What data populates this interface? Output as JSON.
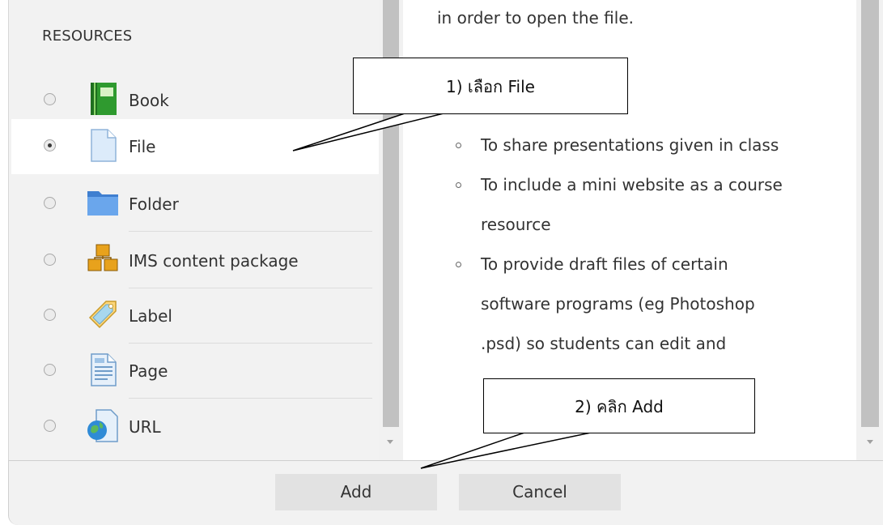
{
  "section_heading": "RESOURCES",
  "options": [
    {
      "label": "Book",
      "icon": "book-icon",
      "selected": false
    },
    {
      "label": "File",
      "icon": "file-icon",
      "selected": true
    },
    {
      "label": "Folder",
      "icon": "folder-icon",
      "selected": false
    },
    {
      "label": "IMS content package",
      "icon": "package-icon",
      "selected": false
    },
    {
      "label": "Label",
      "icon": "label-tag-icon",
      "selected": false
    },
    {
      "label": "Page",
      "icon": "page-icon",
      "selected": false
    },
    {
      "label": "URL",
      "icon": "url-globe-icon",
      "selected": false
    }
  ],
  "help": {
    "intro": "in order to open the file.",
    "bullets": [
      "To share presentations given in class",
      "To include a mini website as a course resource",
      "To provide draft files of certain software programs (eg Photoshop .psd) so students can edit and"
    ]
  },
  "footer": {
    "add_label": "Add",
    "cancel_label": "Cancel"
  },
  "callouts": {
    "step1": "1) เลือก File",
    "step2": "2) คลิก Add"
  },
  "colors": {
    "pane_bg": "#f2f2f2",
    "selected_bg": "#ffffff",
    "button_bg": "#e2e2e2",
    "scrollbar_thumb": "#c1c1c1"
  }
}
